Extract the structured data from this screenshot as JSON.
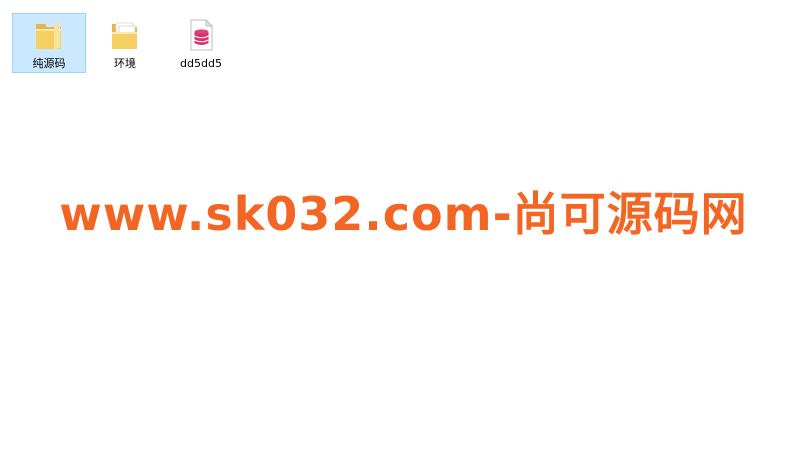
{
  "desktop": {
    "items": [
      {
        "label": "纯源码",
        "icon": "folder-icon",
        "selected": true
      },
      {
        "label": "环境",
        "icon": "folder-with-papers-icon",
        "selected": false
      },
      {
        "label": "dd5dd5",
        "icon": "database-file-icon",
        "selected": false
      }
    ]
  },
  "watermark": {
    "text": "www.sk032.com-尚可源码网",
    "color": "#f26522"
  }
}
